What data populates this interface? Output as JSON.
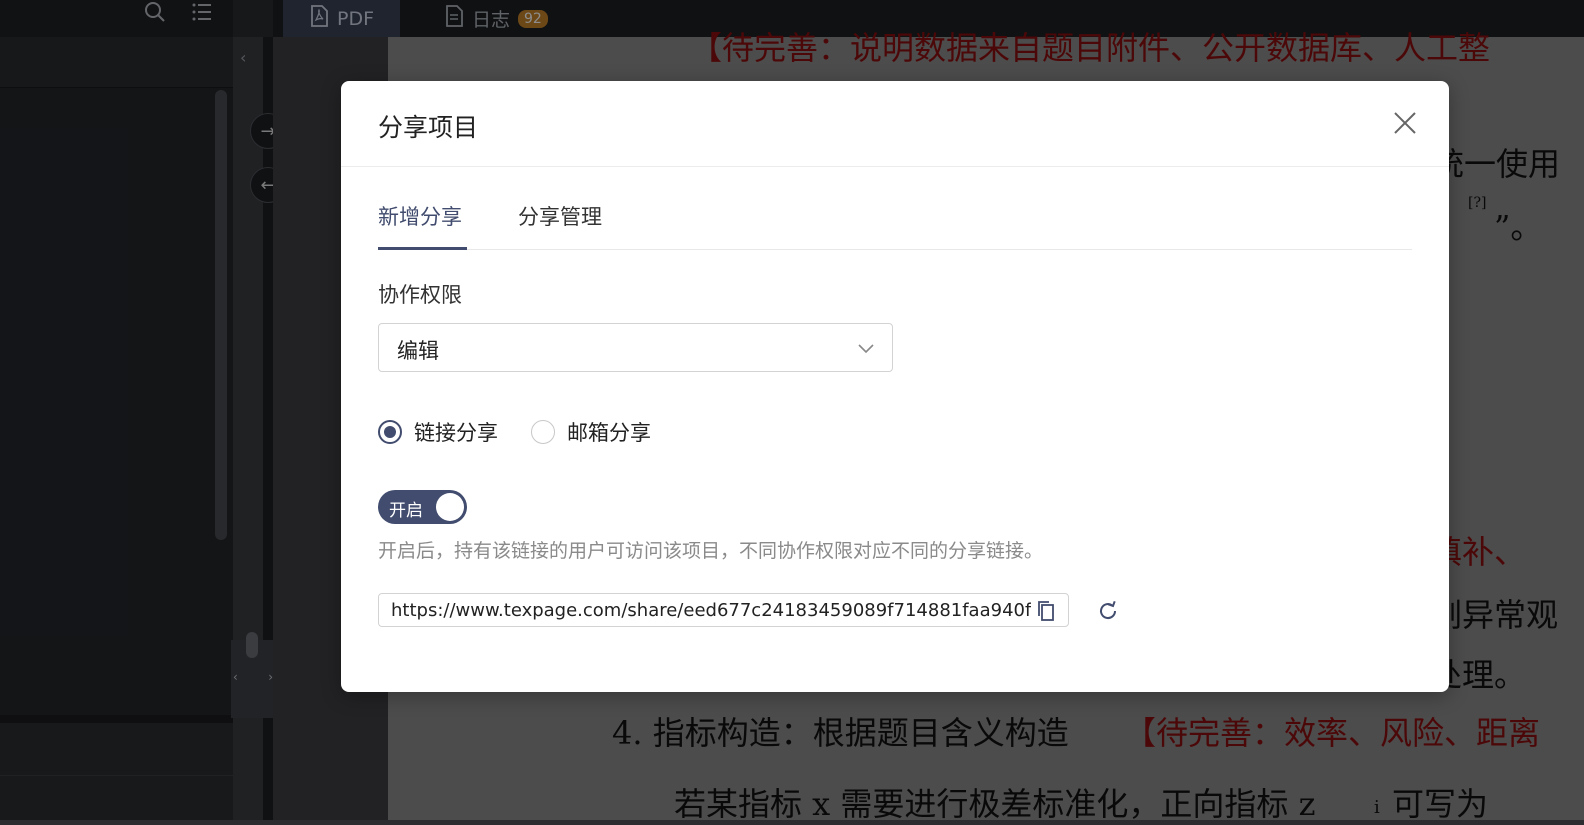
{
  "tabbar": {
    "tabs": [
      {
        "label": "PDF",
        "icon": "pdf-icon"
      },
      {
        "label": "日志",
        "icon": "log-icon",
        "badge": "92"
      }
    ]
  },
  "document": {
    "lines": [
      "【待完善：说明数据来自题目附件、公开数据库、人工整",
      "统一使用",
      "[?]",
      "”。",
      "填补、",
      "剔异常观",
      "处理。",
      "4.  指标构造：根据题目含义构造",
      "【待完善：效率、风险、距离",
      "若某指标 x 需要进行极差标准化，正向指标 z",
      "i",
      "可写为"
    ]
  },
  "modal": {
    "title": "分享项目",
    "tabs": [
      "新增分享",
      "分享管理"
    ],
    "active_tab": "新增分享",
    "permission": {
      "label": "协作权限",
      "value": "编辑"
    },
    "share_mode": {
      "options": [
        "链接分享",
        "邮箱分享"
      ],
      "selected": "链接分享"
    },
    "toggle": {
      "label": "开启",
      "on": true
    },
    "hint": "开启后，持有该链接的用户可访问该项目，不同协作权限对应不同的分享链接。",
    "share_url": "https://www.texpage.com/share/eed677c24183459089f714881faa940f"
  },
  "colors": {
    "accent": "#414c6e",
    "badge": "#c6832a",
    "doc_red": "#8b0f0f"
  }
}
